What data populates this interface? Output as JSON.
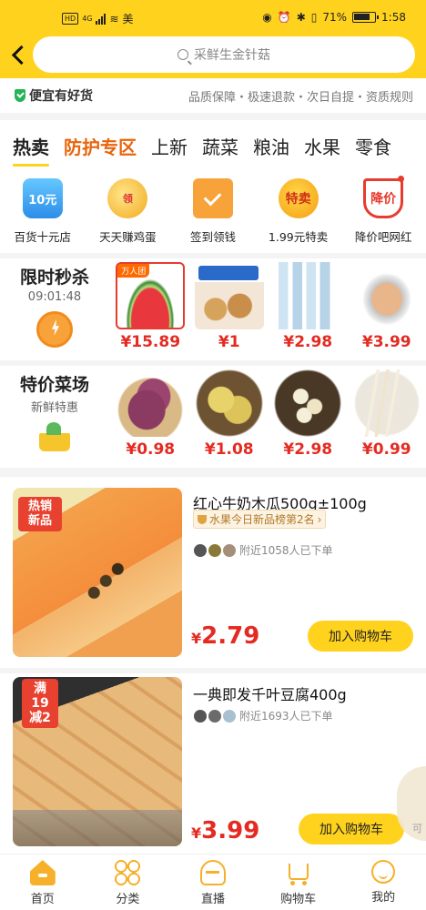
{
  "status_bar": {
    "hd": "HD",
    "network": "4G",
    "left_extra": "美",
    "battery": "71%",
    "time": "1:58"
  },
  "search": {
    "placeholder": "采鲜生金针菇"
  },
  "guarantee": {
    "left": "便宜有好货",
    "right": "品质保障・极速退款・次日自提・资质规则"
  },
  "tabs": [
    "热卖",
    "防护专区",
    "上新",
    "蔬菜",
    "粮油",
    "水果",
    "零食"
  ],
  "shortcuts": [
    {
      "label": "百货十元店",
      "icon_text": "10元"
    },
    {
      "label": "天天赚鸡蛋",
      "icon_text": "领"
    },
    {
      "label": "签到领钱",
      "icon_text": ""
    },
    {
      "label": "1.99元特卖",
      "icon_text": "特卖"
    },
    {
      "label": "降价吧网红",
      "icon_text": "降价"
    }
  ],
  "flash_sale": {
    "title": "限时秒杀",
    "countdown": "09:01:48",
    "tag": "万人团",
    "products": [
      {
        "price": "¥15.89"
      },
      {
        "price": "¥1"
      },
      {
        "price": "¥2.98"
      },
      {
        "price": "¥3.99"
      }
    ]
  },
  "veg_market": {
    "title": "特价菜场",
    "subtitle": "新鲜特惠",
    "products": [
      {
        "price": "¥0.98"
      },
      {
        "price": "¥1.08"
      },
      {
        "price": "¥2.98"
      },
      {
        "price": "¥0.99"
      }
    ]
  },
  "cards": [
    {
      "badge": "热销新品",
      "title": "红心牛奶木瓜500g±100g",
      "rank": "水果今日新品榜第2名",
      "buyers": "附近1058人已下单",
      "price_currency": "¥",
      "price": "2.79",
      "cart": "加入购物车"
    },
    {
      "badge": "满19减2",
      "title": "一典即发千叶豆腐400g",
      "buyers": "附近1693人已下单",
      "price_currency": "¥",
      "price": "3.99",
      "cart": "加入购物车"
    }
  ],
  "float_text": "可",
  "bottom_nav": [
    "首页",
    "分类",
    "直播",
    "购物车",
    "我的"
  ],
  "colors": {
    "brand": "#ffd21e",
    "price": "#e42b22",
    "accent": "#e8650c"
  }
}
